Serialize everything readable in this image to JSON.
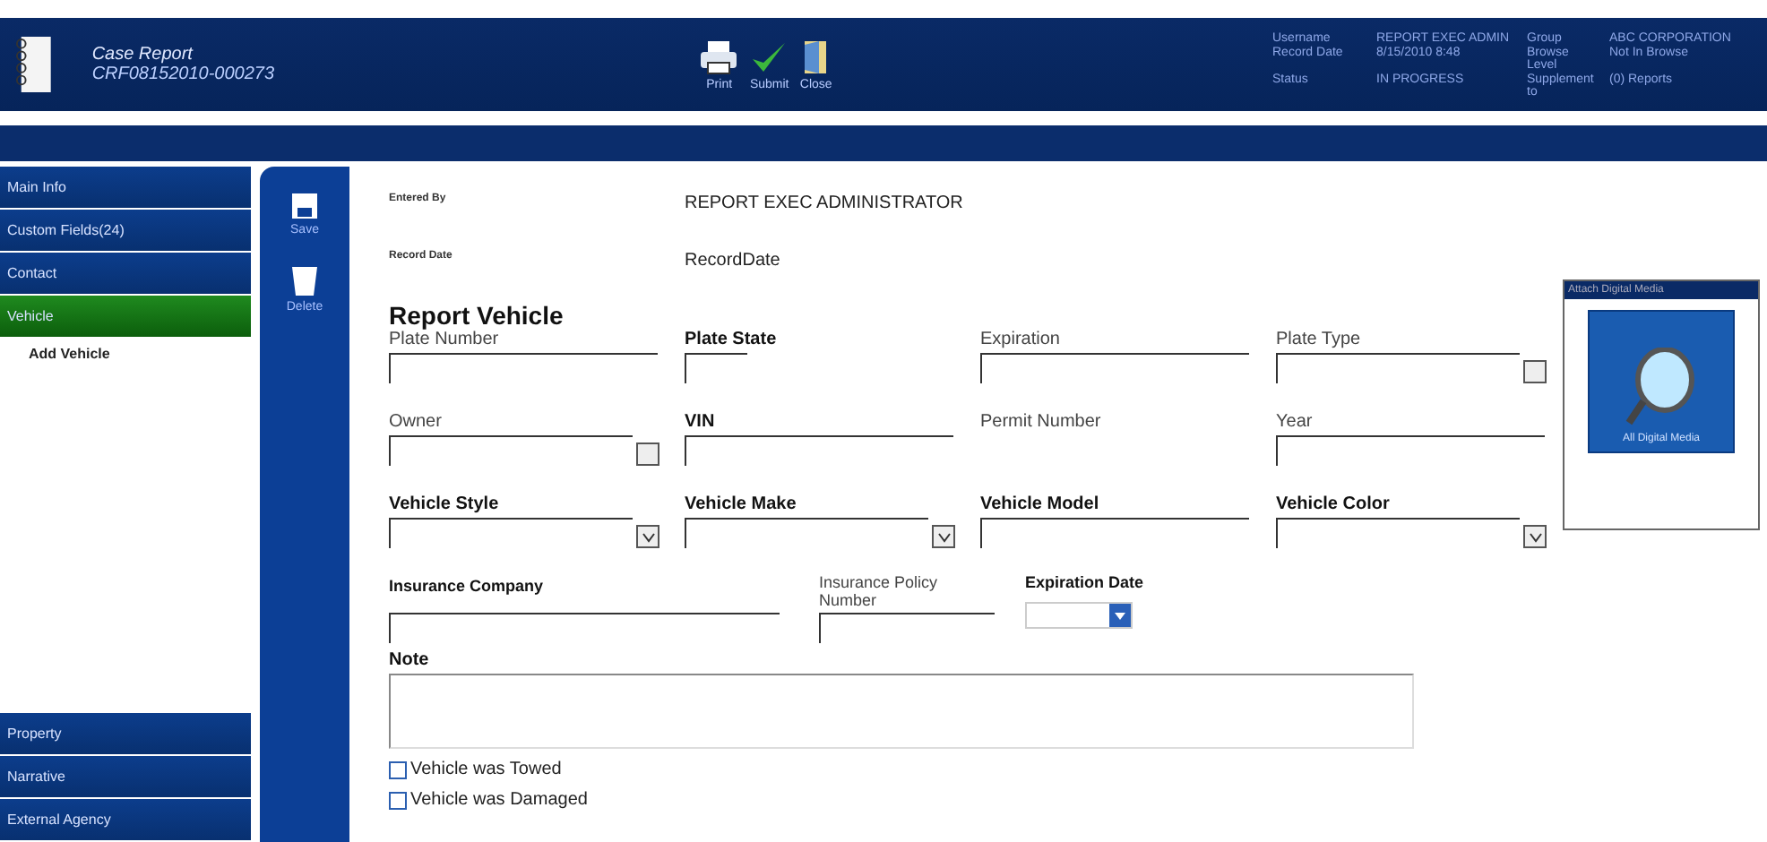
{
  "header": {
    "title": "Case Report",
    "case_number": "CRF08152010-000273",
    "actions": [
      {
        "kind": "print",
        "label": "Print"
      },
      {
        "kind": "submit",
        "label": "Submit"
      },
      {
        "kind": "close",
        "label": "Close"
      }
    ],
    "info": [
      {
        "label": "Username",
        "value": "REPORT EXEC ADMIN"
      },
      {
        "label": "Group",
        "value": "ABC CORPORATION"
      },
      {
        "label": "Record Date",
        "value": "8/15/2010 8:48"
      },
      {
        "label": "Browse Level",
        "value": "Not In Browse"
      },
      {
        "label": "Status",
        "value": "IN PROGRESS"
      },
      {
        "label": "Supplement to",
        "value": "(0) Reports"
      }
    ]
  },
  "nav_top": [
    {
      "label": "Main Info",
      "selected": false
    },
    {
      "label": "Custom Fields(24)",
      "selected": false
    },
    {
      "label": "Contact",
      "selected": false
    },
    {
      "label": "Vehicle",
      "selected": true
    }
  ],
  "sub_nav": [
    "Add Vehicle"
  ],
  "nav_bottom": [
    {
      "label": "Property",
      "selected": false
    },
    {
      "label": "Narrative",
      "selected": false
    },
    {
      "label": "External Agency",
      "selected": false
    }
  ],
  "tools": [
    {
      "kind": "save",
      "label": "Save"
    },
    {
      "kind": "delete",
      "label": "Delete"
    }
  ],
  "meta": [
    {
      "label": "Entered By",
      "value": "REPORT EXEC ADMINISTRATOR"
    },
    {
      "label": "Record Date",
      "value": "RecordDate"
    }
  ],
  "section_title": "Report Vehicle",
  "fields": [
    {
      "label": "Plate Number",
      "kind": "text",
      "bold": false
    },
    {
      "label": "Plate State",
      "kind": "short",
      "bold": true
    },
    {
      "label": "Expiration",
      "kind": "text",
      "bold": false
    },
    {
      "label": "Plate Type",
      "kind": "lookup",
      "bold": false
    },
    {
      "label": "Owner",
      "kind": "lookup",
      "bold": false
    },
    {
      "label": "VIN",
      "kind": "text",
      "bold": true
    },
    {
      "label": "Permit Number",
      "kind": "none",
      "bold": false
    },
    {
      "label": "Year",
      "kind": "text",
      "bold": false
    },
    {
      "label": "Vehicle Style",
      "kind": "select",
      "bold": true
    },
    {
      "label": "Vehicle Make",
      "kind": "select",
      "bold": true
    },
    {
      "label": "Vehicle Model",
      "kind": "text",
      "bold": true
    },
    {
      "label": "Vehicle Color",
      "kind": "select",
      "bold": true
    }
  ],
  "insurance": [
    {
      "label": "Insurance Company",
      "kind": "wide"
    },
    {
      "label": "Insurance Policy Number",
      "kind": "text"
    },
    {
      "label": "Expiration Date",
      "kind": "date"
    }
  ],
  "note_label": "Note",
  "checkboxes": [
    {
      "label": "Vehicle was Towed",
      "checked": false
    },
    {
      "label": "Vehicle was Damaged",
      "checked": false
    }
  ],
  "media": {
    "title": "Attach Digital Media",
    "button": "All Digital Media"
  }
}
